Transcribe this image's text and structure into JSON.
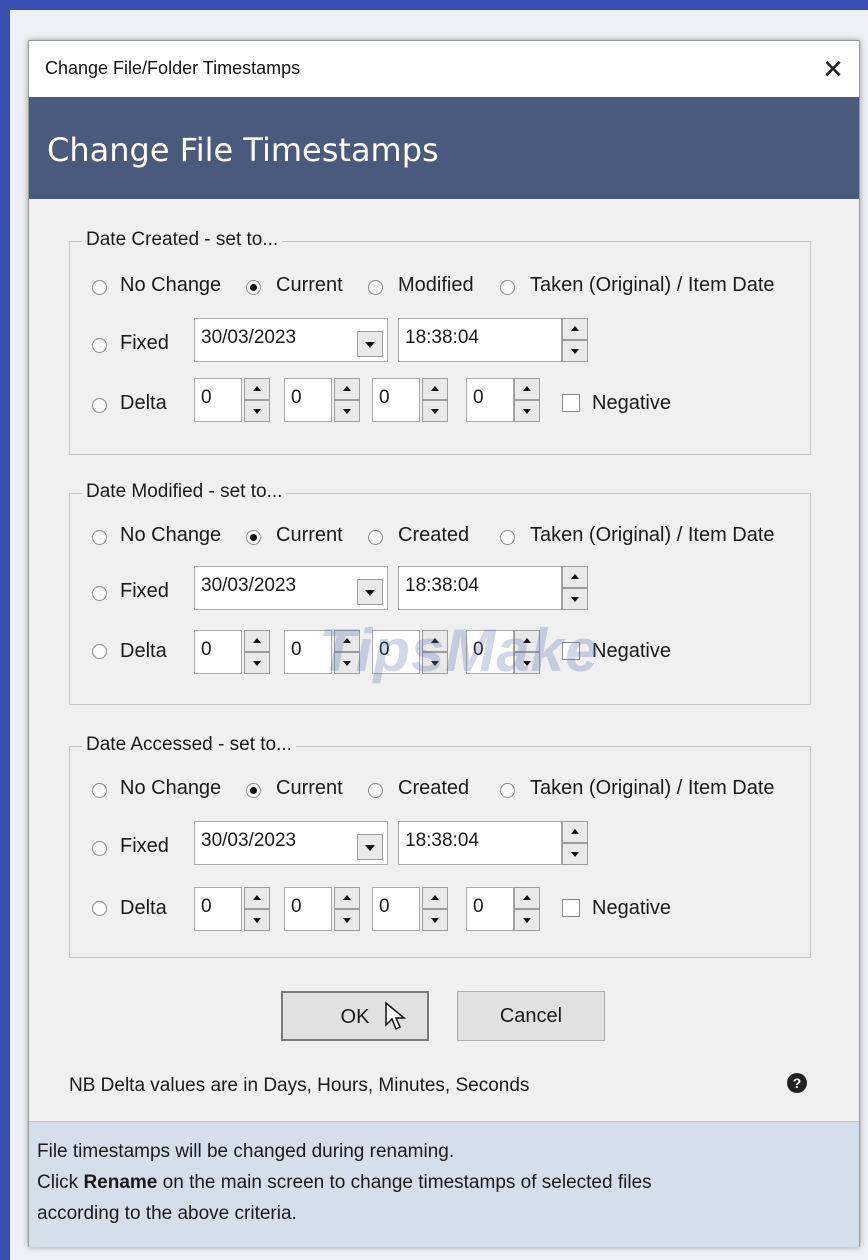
{
  "window": {
    "title": "Change File/Folder Timestamps",
    "close_glyph": "✕"
  },
  "banner": {
    "heading": "Change File Timestamps"
  },
  "groups": [
    {
      "legend": "Date Created - set to...",
      "options": [
        "No Change",
        "Current",
        "Modified",
        "Taken (Original) / Item Date"
      ],
      "selected": 1,
      "fixed_label": "Fixed",
      "fixed_date": "30/03/2023",
      "fixed_time": "18:38:04",
      "delta_label": "Delta",
      "delta_values": [
        "0",
        "0",
        "0",
        "0"
      ],
      "negative_label": "Negative"
    },
    {
      "legend": "Date Modified - set to...",
      "options": [
        "No Change",
        "Current",
        "Created",
        "Taken (Original) / Item Date"
      ],
      "selected": 1,
      "fixed_label": "Fixed",
      "fixed_date": "30/03/2023",
      "fixed_time": "18:38:04",
      "delta_label": "Delta",
      "delta_values": [
        "0",
        "0",
        "0",
        "0"
      ],
      "negative_label": "Negative"
    },
    {
      "legend": "Date Accessed - set to...",
      "options": [
        "No Change",
        "Current",
        "Created",
        "Taken (Original) / Item Date"
      ],
      "selected": 1,
      "fixed_label": "Fixed",
      "fixed_date": "30/03/2023",
      "fixed_time": "18:38:04",
      "delta_label": "Delta",
      "delta_values": [
        "0",
        "0",
        "0",
        "0"
      ],
      "negative_label": "Negative"
    }
  ],
  "buttons": {
    "ok": "OK",
    "cancel": "Cancel"
  },
  "note": "NB Delta values are in Days, Hours, Minutes, Seconds",
  "help_glyph": "?",
  "watermark": "TipsMake",
  "footer": {
    "line1": "File timestamps will be changed during renaming.",
    "line2_pre": "Click ",
    "line2_bold": "Rename",
    "line2_post": " on the main screen to change timestamps of selected files",
    "line3": "according to the above criteria."
  }
}
